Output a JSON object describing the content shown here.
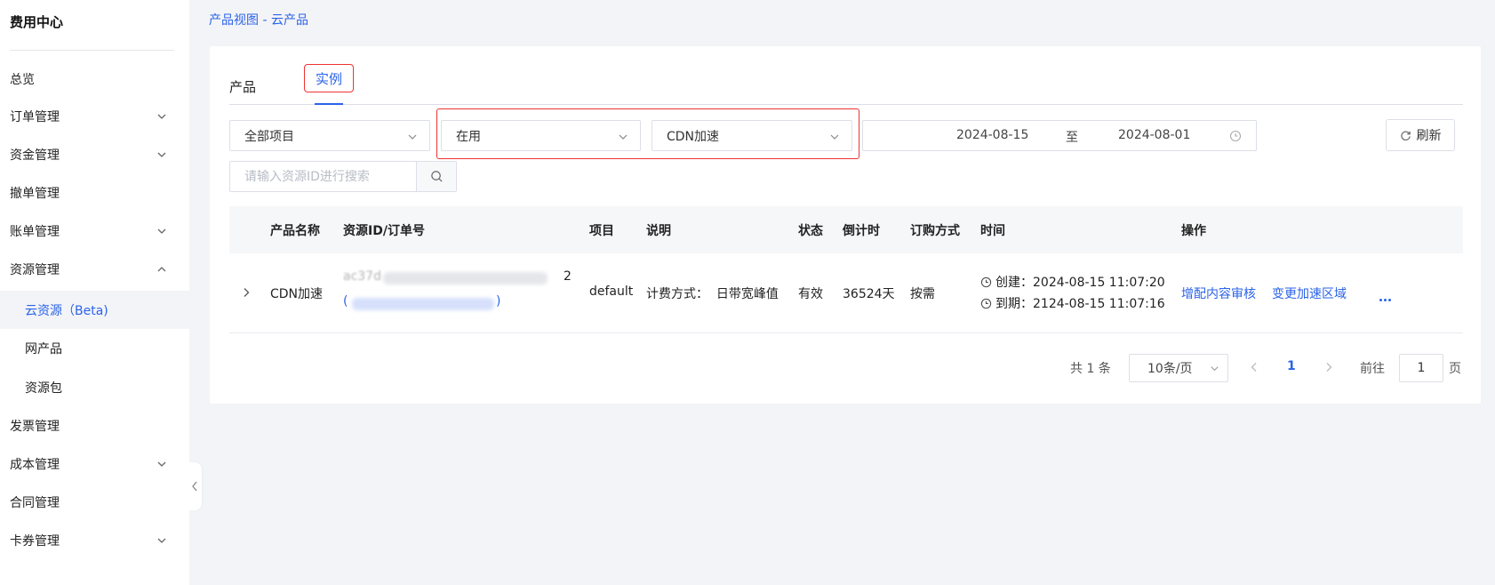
{
  "sidebar": {
    "title": "费用中心",
    "items": [
      {
        "label": "总览"
      },
      {
        "label": "订单管理"
      },
      {
        "label": "资金管理"
      },
      {
        "label": "撤单管理"
      },
      {
        "label": "账单管理"
      },
      {
        "label": "资源管理"
      },
      {
        "label": "云资源（Beta)"
      },
      {
        "label": "网产品"
      },
      {
        "label": "资源包"
      },
      {
        "label": "发票管理"
      },
      {
        "label": "成本管理"
      },
      {
        "label": "合同管理"
      },
      {
        "label": "卡券管理"
      }
    ]
  },
  "breadcrumb": "产品视图 - 云产品",
  "tabs": {
    "products": "产品",
    "instances": "实例"
  },
  "filters": {
    "project": "全部项目",
    "status": "在用",
    "product": "CDN加速",
    "date_start": "2024-08-15",
    "date_separator": "至",
    "date_end": "2024-08-01",
    "refresh_label": "刷新",
    "search_placeholder": "请输入资源ID进行搜索"
  },
  "table": {
    "headers": {
      "product_name": "产品名称",
      "resource_id": "资源ID/订单号",
      "project": "项目",
      "description": "说明",
      "status": "状态",
      "countdown": "倒计时",
      "billing_method": "订购方式",
      "time": "时间",
      "actions": "操作"
    },
    "rows": [
      {
        "product_name": "CDN加速",
        "resource_id_start": "ac37d",
        "resource_id_end": "2",
        "order_open": "(",
        "order_close": ")",
        "project": "default",
        "description": "计费方式：  日带宽峰值",
        "status": "有效",
        "countdown": "36524天",
        "billing_method": "按需",
        "created": "创建：2024-08-15 11:07:20",
        "expires": "到期：2124-08-15 11:07:16",
        "action_1": "增配内容审核",
        "action_2": "变更加速区域"
      }
    ]
  },
  "pagination": {
    "total": "共 1 条",
    "page_size": "10条/页",
    "current_page": "1",
    "goto_label": "前往",
    "goto_value": "1",
    "page_unit": "页"
  },
  "colors": {
    "accent": "#2b63e8",
    "highlight_border": "#e33333"
  }
}
